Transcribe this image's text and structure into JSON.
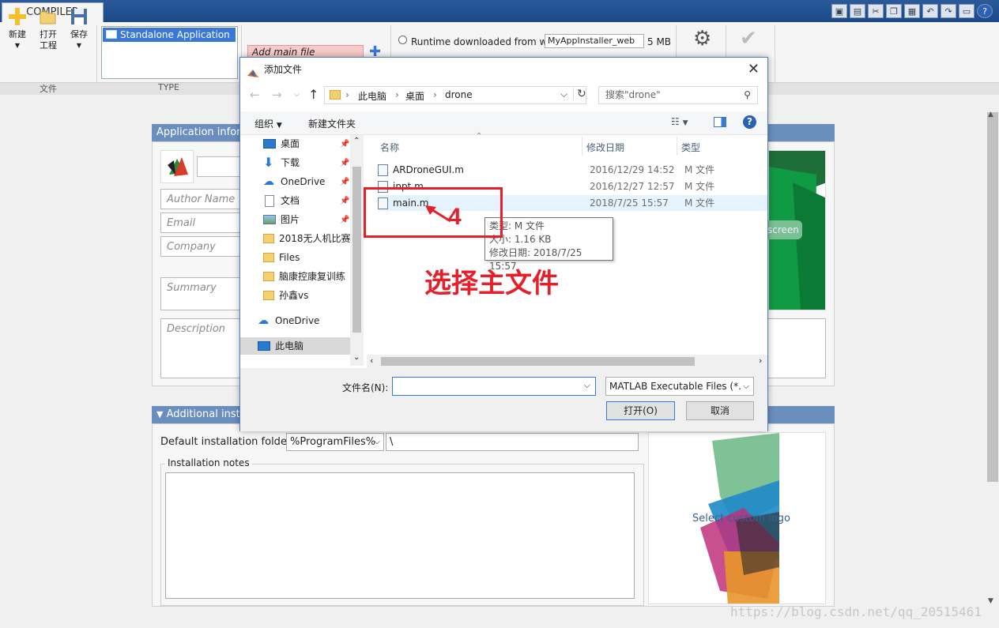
{
  "toolstrip": {
    "tab": "COMPILER",
    "new_label": "新建",
    "open_label_1": "打开",
    "open_label_2": "工程",
    "save_label": "保存",
    "section_file": "文件",
    "section_type": "TYPE",
    "type_selected": "Standalone Application",
    "add_main_file": "Add main file",
    "runtime_label": "Runtime downloaded from web",
    "runtime_value": "MyAppInstaller_web",
    "runtime_size": "5 MB"
  },
  "app_info": {
    "header": "Application inform",
    "author_placeholder": "Author Name",
    "email_placeholder": "Email",
    "company_placeholder": "Company",
    "summary_placeholder": "Summary",
    "description_placeholder": "Description",
    "screenshot_btn": "screen"
  },
  "install": {
    "header": "Additional insta",
    "folder_label": "Default installation folder:",
    "folder_value": "%ProgramFiles%",
    "folder_suffix": "\\",
    "notes_label": "Installation notes",
    "logo_label": "Select custom logo"
  },
  "dialog": {
    "title": "添加文件",
    "breadcrumb": [
      "此电脑",
      "桌面",
      "drone"
    ],
    "search_placeholder": "搜索\"drone\"",
    "organize": "组织",
    "new_folder": "新建文件夹",
    "nav": [
      {
        "label": "桌面",
        "icon": "desktop-icon"
      },
      {
        "label": "下载",
        "icon": "download-icon"
      },
      {
        "label": "OneDrive",
        "icon": "cloud-icon"
      },
      {
        "label": "文档",
        "icon": "document-icon"
      },
      {
        "label": "图片",
        "icon": "picture-icon"
      },
      {
        "label": "2018无人机比赛",
        "icon": "folder-icon"
      },
      {
        "label": "Files",
        "icon": "folder-icon"
      },
      {
        "label": "脑康控康复训练",
        "icon": "folder-icon"
      },
      {
        "label": "孙鑫vs",
        "icon": "folder-icon"
      },
      {
        "label": "OneDrive",
        "icon": "cloud-icon"
      },
      {
        "label": "此电脑",
        "icon": "computer-icon"
      }
    ],
    "columns": {
      "name": "名称",
      "date": "修改日期",
      "type": "类型"
    },
    "files": [
      {
        "name": "ARDroneGUI.m",
        "date": "2016/12/29 14:52",
        "type": "M 文件"
      },
      {
        "name": "inpt.m",
        "date": "2016/12/27 12:57",
        "type": "M 文件"
      },
      {
        "name": "main.m",
        "date": "2018/7/25 15:57",
        "type": "M 文件"
      }
    ],
    "tooltip": {
      "line1": "类型: M 文件",
      "line2": "大小: 1.16 KB",
      "line3": "修改日期: 2018/7/25 15:57"
    },
    "filename_label": "文件名(N):",
    "filename_value": "",
    "filter": "MATLAB Executable Files (*.r",
    "open_btn": "打开(O)",
    "cancel_btn": "取消"
  },
  "annotation": {
    "step": "4",
    "text": "选择主文件"
  },
  "watermark": "https://blog.csdn.net/qq_20515461"
}
